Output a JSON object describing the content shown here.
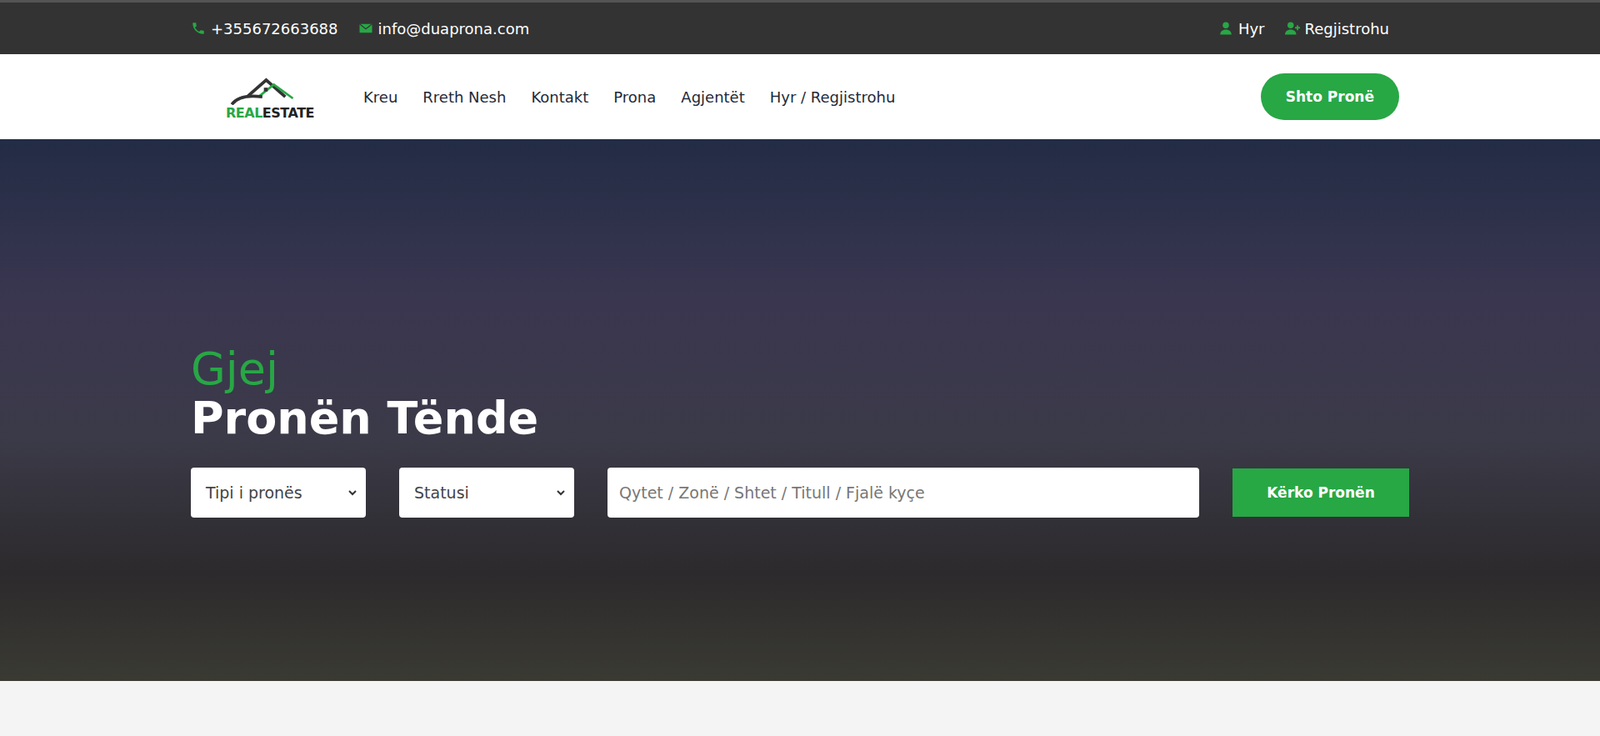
{
  "topbar": {
    "phone": "+355672663688",
    "email": "info@duaprona.com",
    "links": [
      {
        "label": "Hyr",
        "kind": "login"
      },
      {
        "label": "Regjistrohu",
        "kind": "register"
      }
    ]
  },
  "logo": {
    "accent": "REAL",
    "rest": "ESTATE"
  },
  "nav": {
    "items": [
      "Kreu",
      "Rreth Nesh",
      "Kontakt",
      "Prona",
      "Agjentët",
      "Hyr / Regjistrohu"
    ],
    "cta": "Shto Pronë"
  },
  "hero": {
    "accent": "Gjej",
    "title": "Pronën Tënde"
  },
  "search": {
    "type": "Tipi i pronës",
    "status": "Statusi",
    "placeholder": "Qytet / Zonë / Shtet / Titull / Fjalë kyçe",
    "button": "Kërko Pronën"
  }
}
